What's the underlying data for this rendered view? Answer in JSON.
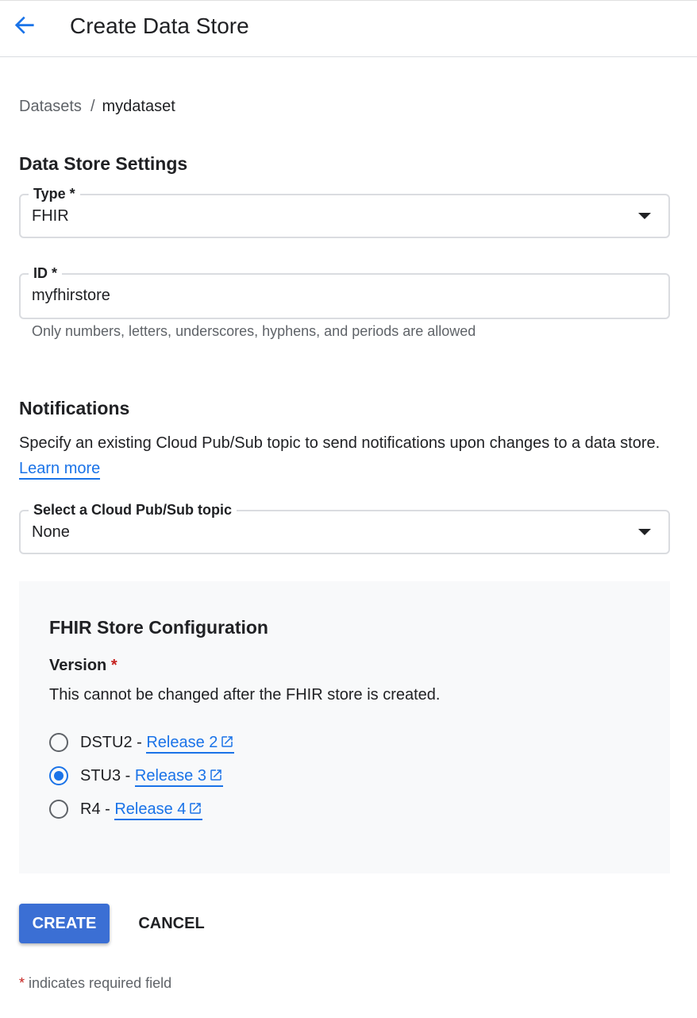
{
  "header": {
    "title": "Create Data Store"
  },
  "breadcrumb": {
    "items": [
      "Datasets",
      "mydataset"
    ],
    "separator": "/"
  },
  "settings": {
    "heading": "Data Store Settings",
    "type": {
      "label": "Type *",
      "value": "FHIR"
    },
    "id": {
      "label": "ID *",
      "value": "myfhirstore",
      "hint": "Only numbers, letters, underscores, hyphens, and periods are allowed"
    }
  },
  "notifications": {
    "heading": "Notifications",
    "description": "Specify an existing Cloud Pub/Sub topic to send notifications upon changes to a data store.",
    "learn_more": "Learn more",
    "topic": {
      "label": "Select a Cloud Pub/Sub topic",
      "value": "None"
    }
  },
  "fhir_config": {
    "heading": "FHIR Store Configuration",
    "version_label": "Version",
    "required_mark": "*",
    "version_desc": "This cannot be changed after the FHIR store is created.",
    "options": [
      {
        "prefix": "DSTU2 - ",
        "link": "Release 2",
        "selected": false
      },
      {
        "prefix": "STU3 - ",
        "link": "Release 3",
        "selected": true
      },
      {
        "prefix": "R4 - ",
        "link": "Release 4",
        "selected": false
      }
    ]
  },
  "actions": {
    "create": "CREATE",
    "cancel": "CANCEL"
  },
  "footnote": {
    "mark": "*",
    "text": " indicates required field"
  },
  "colors": {
    "accent": "#1a73e8",
    "primary_button": "#3b6fd4",
    "required": "#c5221f"
  },
  "icons": {
    "back": "arrow-back-icon",
    "dropdown": "arrow-drop-down-icon",
    "external": "open-in-new-icon"
  }
}
